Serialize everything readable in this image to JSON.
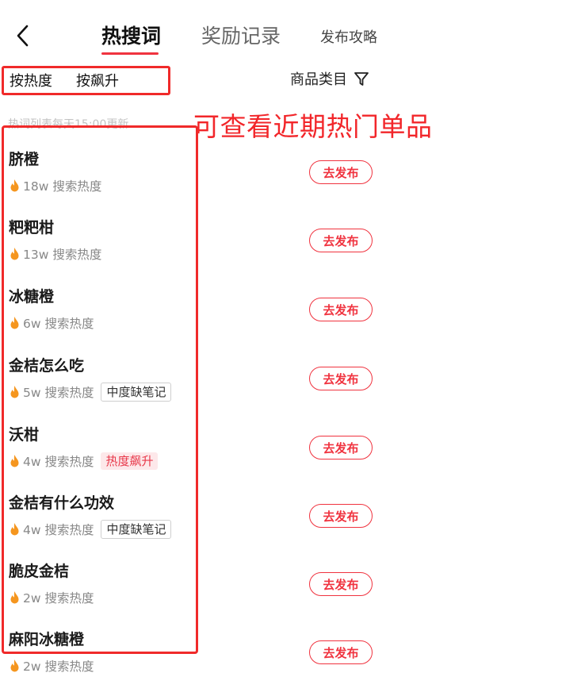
{
  "header": {
    "tabs": [
      "热搜词",
      "奖励记录",
      "发布攻略"
    ]
  },
  "filters": {
    "sort_by_heat": "按热度",
    "sort_by_rise": "按飙升",
    "category": "商品类目"
  },
  "hint": "热词列表每天15:00更新",
  "annotation": "可查看近期热门单品",
  "items": [
    {
      "title": "脐橙",
      "heat": "18w 搜索热度",
      "badge": "",
      "action": "去发布"
    },
    {
      "title": "粑粑柑",
      "heat": "13w 搜索热度",
      "badge": "",
      "action": "去发布"
    },
    {
      "title": "冰糖橙",
      "heat": "6w 搜索热度",
      "badge": "",
      "action": "去发布"
    },
    {
      "title": "金桔怎么吃",
      "heat": "5w 搜索热度",
      "badge": "中度缺笔记",
      "action": "去发布"
    },
    {
      "title": "沃柑",
      "heat": "4w 搜索热度",
      "badge": "热度飙升",
      "action": "去发布"
    },
    {
      "title": "金桔有什么功效",
      "heat": "4w 搜索热度",
      "badge": "中度缺笔记",
      "action": "去发布"
    },
    {
      "title": "脆皮金桔",
      "heat": "2w 搜索热度",
      "badge": "",
      "action": "去发布"
    },
    {
      "title": "麻阳冰糖橙",
      "heat": "2w 搜索热度",
      "badge": "",
      "action": "去发布"
    }
  ],
  "colors": {
    "accent": "#f0333f",
    "annotation": "#f2262a",
    "flame": "#f5961f"
  }
}
